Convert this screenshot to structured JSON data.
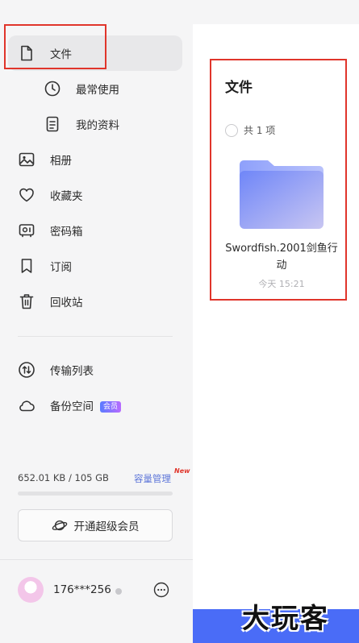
{
  "sidebar": {
    "items": [
      {
        "label": "文件",
        "icon": "file-icon",
        "active": true
      },
      {
        "label": "最常使用",
        "icon": "clock-icon"
      },
      {
        "label": "我的资料",
        "icon": "document-icon"
      },
      {
        "label": "相册",
        "icon": "image-icon"
      },
      {
        "label": "收藏夹",
        "icon": "heart-icon"
      },
      {
        "label": "密码箱",
        "icon": "safe-icon"
      },
      {
        "label": "订阅",
        "icon": "bookmark-icon"
      },
      {
        "label": "回收站",
        "icon": "trash-icon"
      },
      {
        "label": "传输列表",
        "icon": "transfer-icon"
      },
      {
        "label": "备份空间",
        "icon": "cloud-icon",
        "badge": "会员"
      }
    ],
    "storage": {
      "text": "652.01 KB / 105 GB",
      "manage_label": "容量管理",
      "new_tag": "New",
      "used_fraction": 0.0
    },
    "vip_button": "开通超级会员",
    "user": {
      "name": "176***256"
    }
  },
  "main": {
    "title": "文件",
    "count": "共 1 项",
    "files": [
      {
        "name": "Swordfish.2001剑鱼行动",
        "time": "今天 15:21"
      }
    ]
  },
  "watermark": "大玩客",
  "colors": {
    "accent": "#5b7cff",
    "highlight_box": "#e0352b",
    "banner": "#4a6cf7"
  }
}
